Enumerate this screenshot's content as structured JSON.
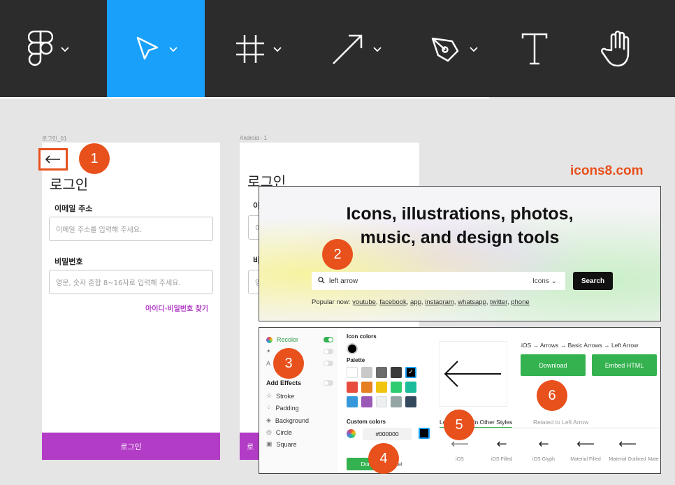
{
  "toolbar": {
    "tools": [
      "figma-menu",
      "move",
      "frame",
      "line",
      "pen",
      "text",
      "hand"
    ]
  },
  "frames": [
    {
      "label": "로그인_01",
      "title": "로그인",
      "email_label": "이메일 주소",
      "email_placeholder": "이메일 주소를 입력해 주세요.",
      "password_label": "비밀번호",
      "password_placeholder": "영문, 숫자 혼합 8~16자로 입력해 주세요.",
      "find_link": "아이디·비밀번호 찾기",
      "login_button": "로그인"
    },
    {
      "label": "Android - 1",
      "title": "로그인",
      "email_label_partial": "이",
      "email_placeholder_partial": "이",
      "password_label_partial": "비",
      "password_placeholder_partial": "영",
      "login_button_partial": "로"
    }
  ],
  "badges": [
    "1",
    "2",
    "3",
    "4",
    "5",
    "6"
  ],
  "brand": "icons8.com",
  "hero": {
    "title_line1": "Icons, illustrations, photos,",
    "title_line2": "music, and design tools",
    "search_value": "left arrow",
    "search_type": "Icons ⌄",
    "search_button": "Search",
    "popular_label": "Popular now:",
    "popular_links": [
      "youtube",
      "facebook",
      "app",
      "instagram",
      "whatsapp",
      "twitter",
      "phone"
    ]
  },
  "editor": {
    "side_items": {
      "recolor": "Recolor",
      "a_item": "A",
      "add_effects": "Add Effects",
      "stroke": "Stroke",
      "padding": "Padding",
      "background": "Background",
      "circle": "Circle",
      "square": "Square"
    },
    "icon_colors_title": "Icon colors",
    "palette_title": "Palette",
    "palette": [
      "#ffffff",
      "#c8c8c8",
      "#6b6b6b",
      "#3a3a3a",
      "#000000",
      "#e74c3c",
      "#e67e22",
      "#f1c40f",
      "#2ecc71",
      "#1abc9c",
      "#3498db",
      "#9b59b6",
      "#ecf0f1",
      "#95a5a6",
      "#34495e"
    ],
    "custom_colors_title": "Custom colors",
    "hex_value": "#000000",
    "done": "Done",
    "cancel": "ncel",
    "breadcrumb": "iOS → Arrows → Basic Arrows → Left Arrow",
    "download": "Download",
    "embed": "Embed HTML",
    "tab_active": "Left Arrow Icon in Other Styles",
    "tab_active_left": "Le",
    "tab_active_right": "n in Other Styles",
    "tab_inactive": "Related to Left Arrow",
    "styles": [
      "iOS",
      "iOS Filled",
      "iOS Glyph",
      "Material Filled",
      "Material Outlined",
      "Mate"
    ]
  },
  "colors": {
    "accent_orange": "#e8501c",
    "figma_blue": "#18a0fb",
    "login_purple": "#b23cc6",
    "icons8_green": "#33b24f"
  }
}
